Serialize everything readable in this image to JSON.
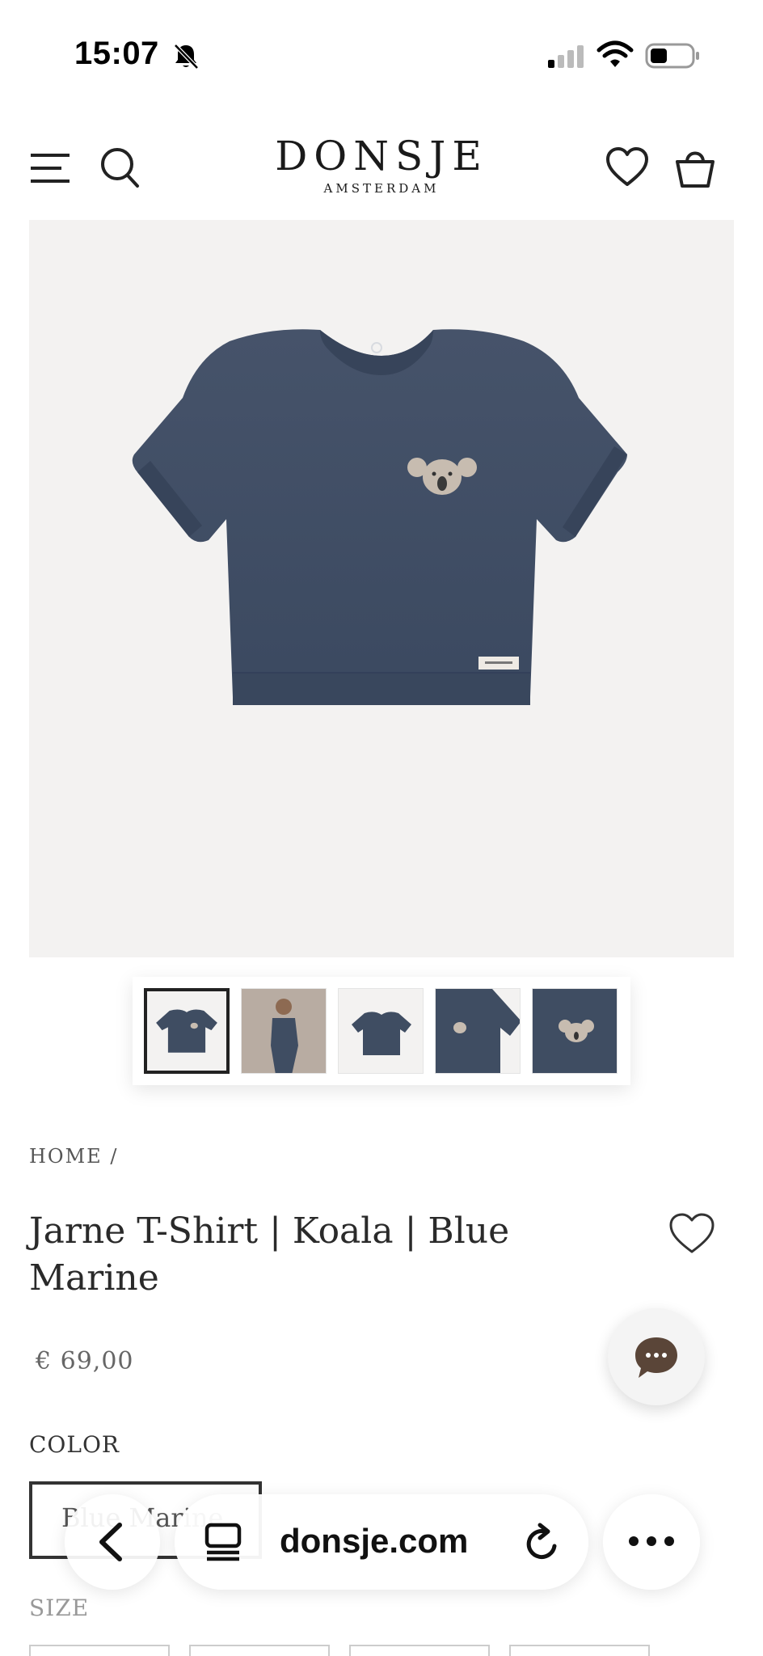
{
  "status_bar": {
    "time": "15:07",
    "icons": [
      "bell-slash-icon",
      "signal-icon",
      "wifi-icon",
      "battery-icon"
    ]
  },
  "header": {
    "brand_name": "DONSJE",
    "brand_sub": "AMSTERDAM",
    "icons": [
      "menu-icon",
      "search-icon",
      "heart-icon",
      "bag-icon"
    ]
  },
  "product": {
    "breadcrumb": "HOME /",
    "title": "Jarne T-Shirt | Koala | Blue Marine",
    "price": "€ 69,00",
    "color_label": "COLOR",
    "color_selected": "Blue Marine",
    "size_label": "SIZE",
    "thumbnails_count": 5,
    "active_thumbnail": 1
  },
  "browser": {
    "url": "donsje.com"
  },
  "colors": {
    "shirt": "#3f4d62",
    "hero_bg": "#f3f2f1",
    "koala_patch": "#c7bcb0",
    "chat_icon": "#5a4538"
  }
}
